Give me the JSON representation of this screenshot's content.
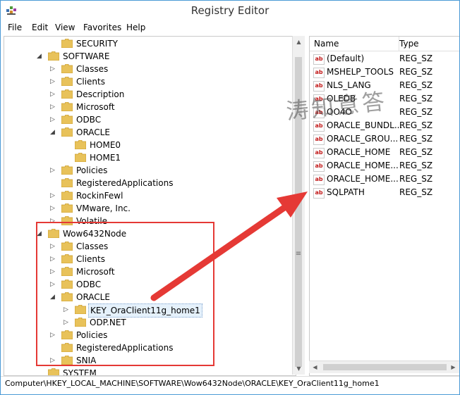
{
  "window": {
    "title": "Registry Editor"
  },
  "menu": [
    "File",
    "Edit",
    "View",
    "Favorites",
    "Help"
  ],
  "tree": [
    {
      "label": "SECURITY",
      "expander": ""
    },
    {
      "label": "SOFTWARE",
      "expander": "◢"
    },
    {
      "label": "Classes",
      "expander": "▷"
    },
    {
      "label": "Clients",
      "expander": "▷"
    },
    {
      "label": "Description",
      "expander": "▷"
    },
    {
      "label": "Microsoft",
      "expander": "▷"
    },
    {
      "label": "ODBC",
      "expander": "▷"
    },
    {
      "label": "ORACLE",
      "expander": "◢"
    },
    {
      "label": "HOME0",
      "expander": ""
    },
    {
      "label": "HOME1",
      "expander": ""
    },
    {
      "label": "Policies",
      "expander": "▷"
    },
    {
      "label": "RegisteredApplications",
      "expander": ""
    },
    {
      "label": "RockinFewl",
      "expander": "▷"
    },
    {
      "label": "VMware, Inc.",
      "expander": "▷"
    },
    {
      "label": "Volatile",
      "expander": "▷"
    },
    {
      "label": "Wow6432Node",
      "expander": "◢"
    },
    {
      "label": "Classes",
      "expander": "▷"
    },
    {
      "label": "Clients",
      "expander": "▷"
    },
    {
      "label": "Microsoft",
      "expander": "▷"
    },
    {
      "label": "ODBC",
      "expander": "▷"
    },
    {
      "label": "ORACLE",
      "expander": "◢"
    },
    {
      "label": "KEY_OraClient11g_home1",
      "expander": "▷"
    },
    {
      "label": "ODP.NET",
      "expander": "▷"
    },
    {
      "label": "Policies",
      "expander": "▷"
    },
    {
      "label": "RegisteredApplications",
      "expander": ""
    },
    {
      "label": "SNIA",
      "expander": "▷"
    },
    {
      "label": "SYSTEM",
      "expander": ""
    }
  ],
  "values_header": {
    "name": "Name",
    "type": "Type"
  },
  "values": [
    {
      "name": "(Default)",
      "type": "REG_SZ"
    },
    {
      "name": "MSHELP_TOOLS",
      "type": "REG_SZ"
    },
    {
      "name": "NLS_LANG",
      "type": "REG_SZ"
    },
    {
      "name": "OLEDB",
      "type": "REG_SZ"
    },
    {
      "name": "OO4O",
      "type": "REG_SZ"
    },
    {
      "name": "ORACLE_BUNDL...",
      "type": "REG_SZ"
    },
    {
      "name": "ORACLE_GROU...",
      "type": "REG_SZ"
    },
    {
      "name": "ORACLE_HOME",
      "type": "REG_SZ"
    },
    {
      "name": "ORACLE_HOME...",
      "type": "REG_SZ"
    },
    {
      "name": "ORACLE_HOME...",
      "type": "REG_SZ"
    },
    {
      "name": "SQLPATH",
      "type": "REG_SZ"
    }
  ],
  "value_icon": "ab",
  "status": "Computer\\HKEY_LOCAL_MACHINE\\SOFTWARE\\Wow6432Node\\ORACLE\\KEY_OraClient11g_home1",
  "watermark": "涛知意答",
  "colors": {
    "annotation": "#e53935",
    "folder": "#e8c25a",
    "selection": "#e5f1fb"
  }
}
